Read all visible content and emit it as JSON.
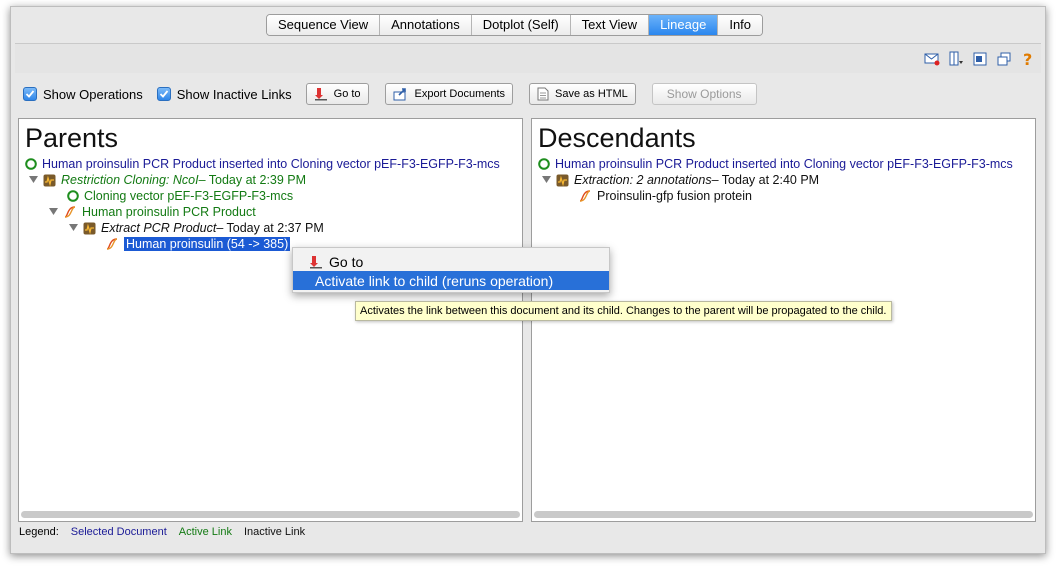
{
  "tabs": [
    {
      "label": "Sequence View"
    },
    {
      "label": "Annotations"
    },
    {
      "label": "Dotplot (Self)"
    },
    {
      "label": "Text View"
    },
    {
      "label": "Lineage"
    },
    {
      "label": "Info"
    }
  ],
  "active_tab": "Lineage",
  "toolbar": {
    "show_operations_label": "Show Operations",
    "show_operations_checked": true,
    "show_inactive_label": "Show Inactive Links",
    "show_inactive_checked": true,
    "goto_label": "Go to",
    "export_label": "Export Documents",
    "save_html_label": "Save as HTML",
    "show_options_label": "Show Options"
  },
  "top_icons": [
    "mail-icon",
    "split-view-icon",
    "minimize-icon",
    "restore-icon",
    "help-icon"
  ],
  "parents": {
    "title": "Parents",
    "nodes": [
      {
        "text": "Human proinsulin PCR Product inserted into Cloning vector pEF-F3-EGFP-F3-mcs"
      },
      {
        "text_italic": "Restriction Cloning: NcoI",
        "text_rest": " – Today at 2:39 PM"
      },
      {
        "text": "Cloning vector pEF-F3-EGFP-F3-mcs"
      },
      {
        "text": "Human proinsulin PCR Product"
      },
      {
        "text_italic": "Extract PCR Product",
        "text_rest": " – Today at 2:37 PM"
      },
      {
        "text": "Human proinsulin (54 -> 385)"
      }
    ]
  },
  "descendants": {
    "title": "Descendants",
    "nodes": [
      {
        "text": "Human proinsulin PCR Product inserted into Cloning vector pEF-F3-EGFP-F3-mcs"
      },
      {
        "text_italic": "Extraction: 2 annotations",
        "text_rest": " – Today at 2:40 PM"
      },
      {
        "text": "Proinsulin-gfp fusion protein"
      }
    ]
  },
  "legend": {
    "label": "Legend:",
    "selected": "Selected Document",
    "active": "Active Link",
    "inactive": "Inactive Link"
  },
  "context_menu": {
    "goto": "Go to",
    "activate": "Activate link to child (reruns operation)"
  },
  "tooltip": "Activates the link between this document and its child. Changes to the parent will be propagated to the child.",
  "colors": {
    "selected_document": "#1a1a96",
    "active_link": "#137a13",
    "inactive_link": "#111111",
    "highlight": "#2870d8"
  }
}
